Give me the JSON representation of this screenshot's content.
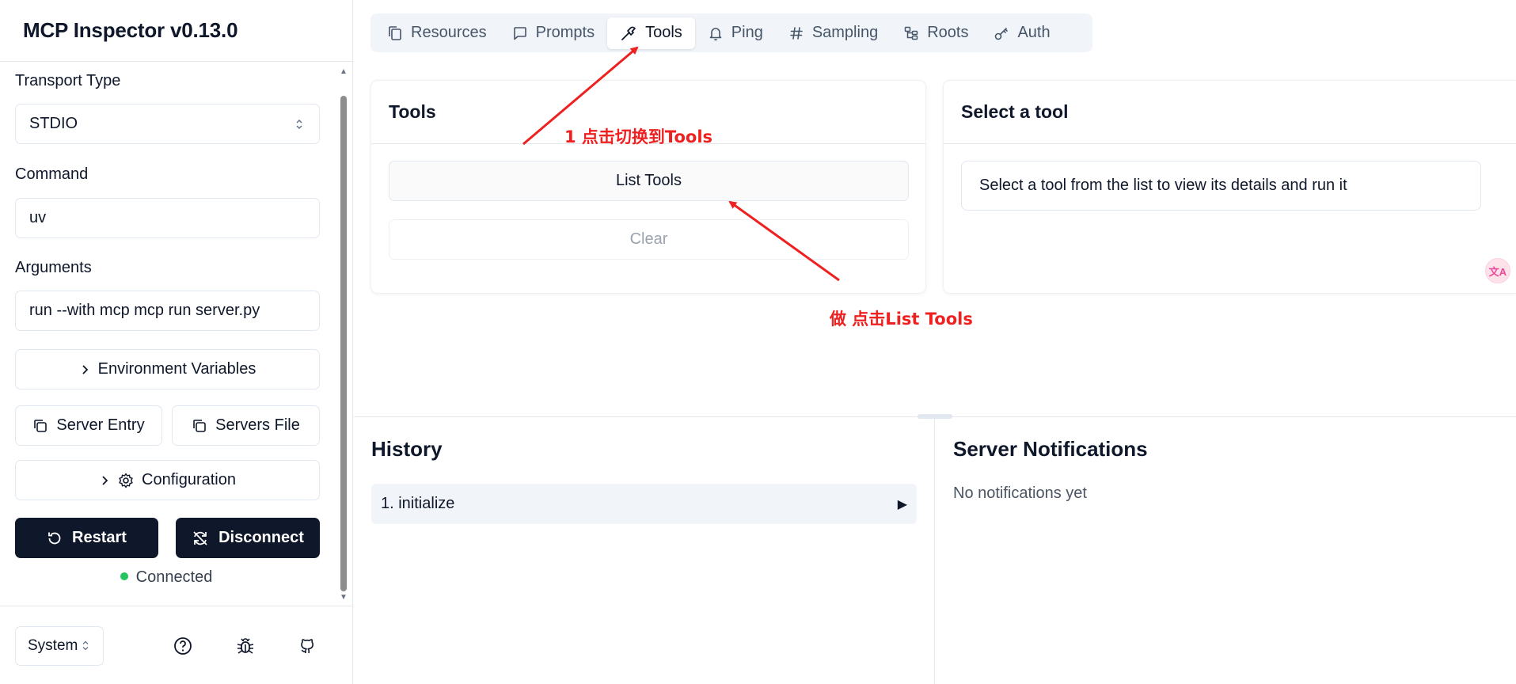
{
  "app": {
    "title": "MCP Inspector v0.13.0"
  },
  "sidebar": {
    "transport_label": "Transport Type",
    "transport_value": "STDIO",
    "command_label": "Command",
    "command_value": "uv",
    "arguments_label": "Arguments",
    "arguments_value": "run --with mcp mcp run server.py",
    "env_button": "Environment Variables",
    "server_entry_button": "Server Entry",
    "servers_file_button": "Servers File",
    "config_button": "Configuration",
    "restart_button": "Restart",
    "disconnect_button": "Disconnect",
    "status_text": "Connected",
    "status_color": "#22c55e",
    "theme_value": "System"
  },
  "tabs": [
    {
      "label": "Resources",
      "icon": "files-icon"
    },
    {
      "label": "Prompts",
      "icon": "message-square-icon"
    },
    {
      "label": "Tools",
      "icon": "hammer-icon",
      "active": true
    },
    {
      "label": "Ping",
      "icon": "bell-icon"
    },
    {
      "label": "Sampling",
      "icon": "hash-icon"
    },
    {
      "label": "Roots",
      "icon": "folder-tree-icon"
    },
    {
      "label": "Auth",
      "icon": "key-icon"
    }
  ],
  "tools_panel": {
    "title": "Tools",
    "list_button": "List Tools",
    "clear_button": "Clear"
  },
  "detail_panel": {
    "title": "Select a tool",
    "hint": "Select a tool from the list to view its details and run it"
  },
  "history": {
    "title": "History",
    "items": [
      {
        "label": "1. initialize"
      }
    ]
  },
  "notifications": {
    "title": "Server Notifications",
    "empty_text": "No notifications yet"
  },
  "annotations": {
    "step1": "1 点击切换到Tools",
    "step2": "做 点击List Tools",
    "color": "#ef2020"
  },
  "floating_widget_text": "文A"
}
